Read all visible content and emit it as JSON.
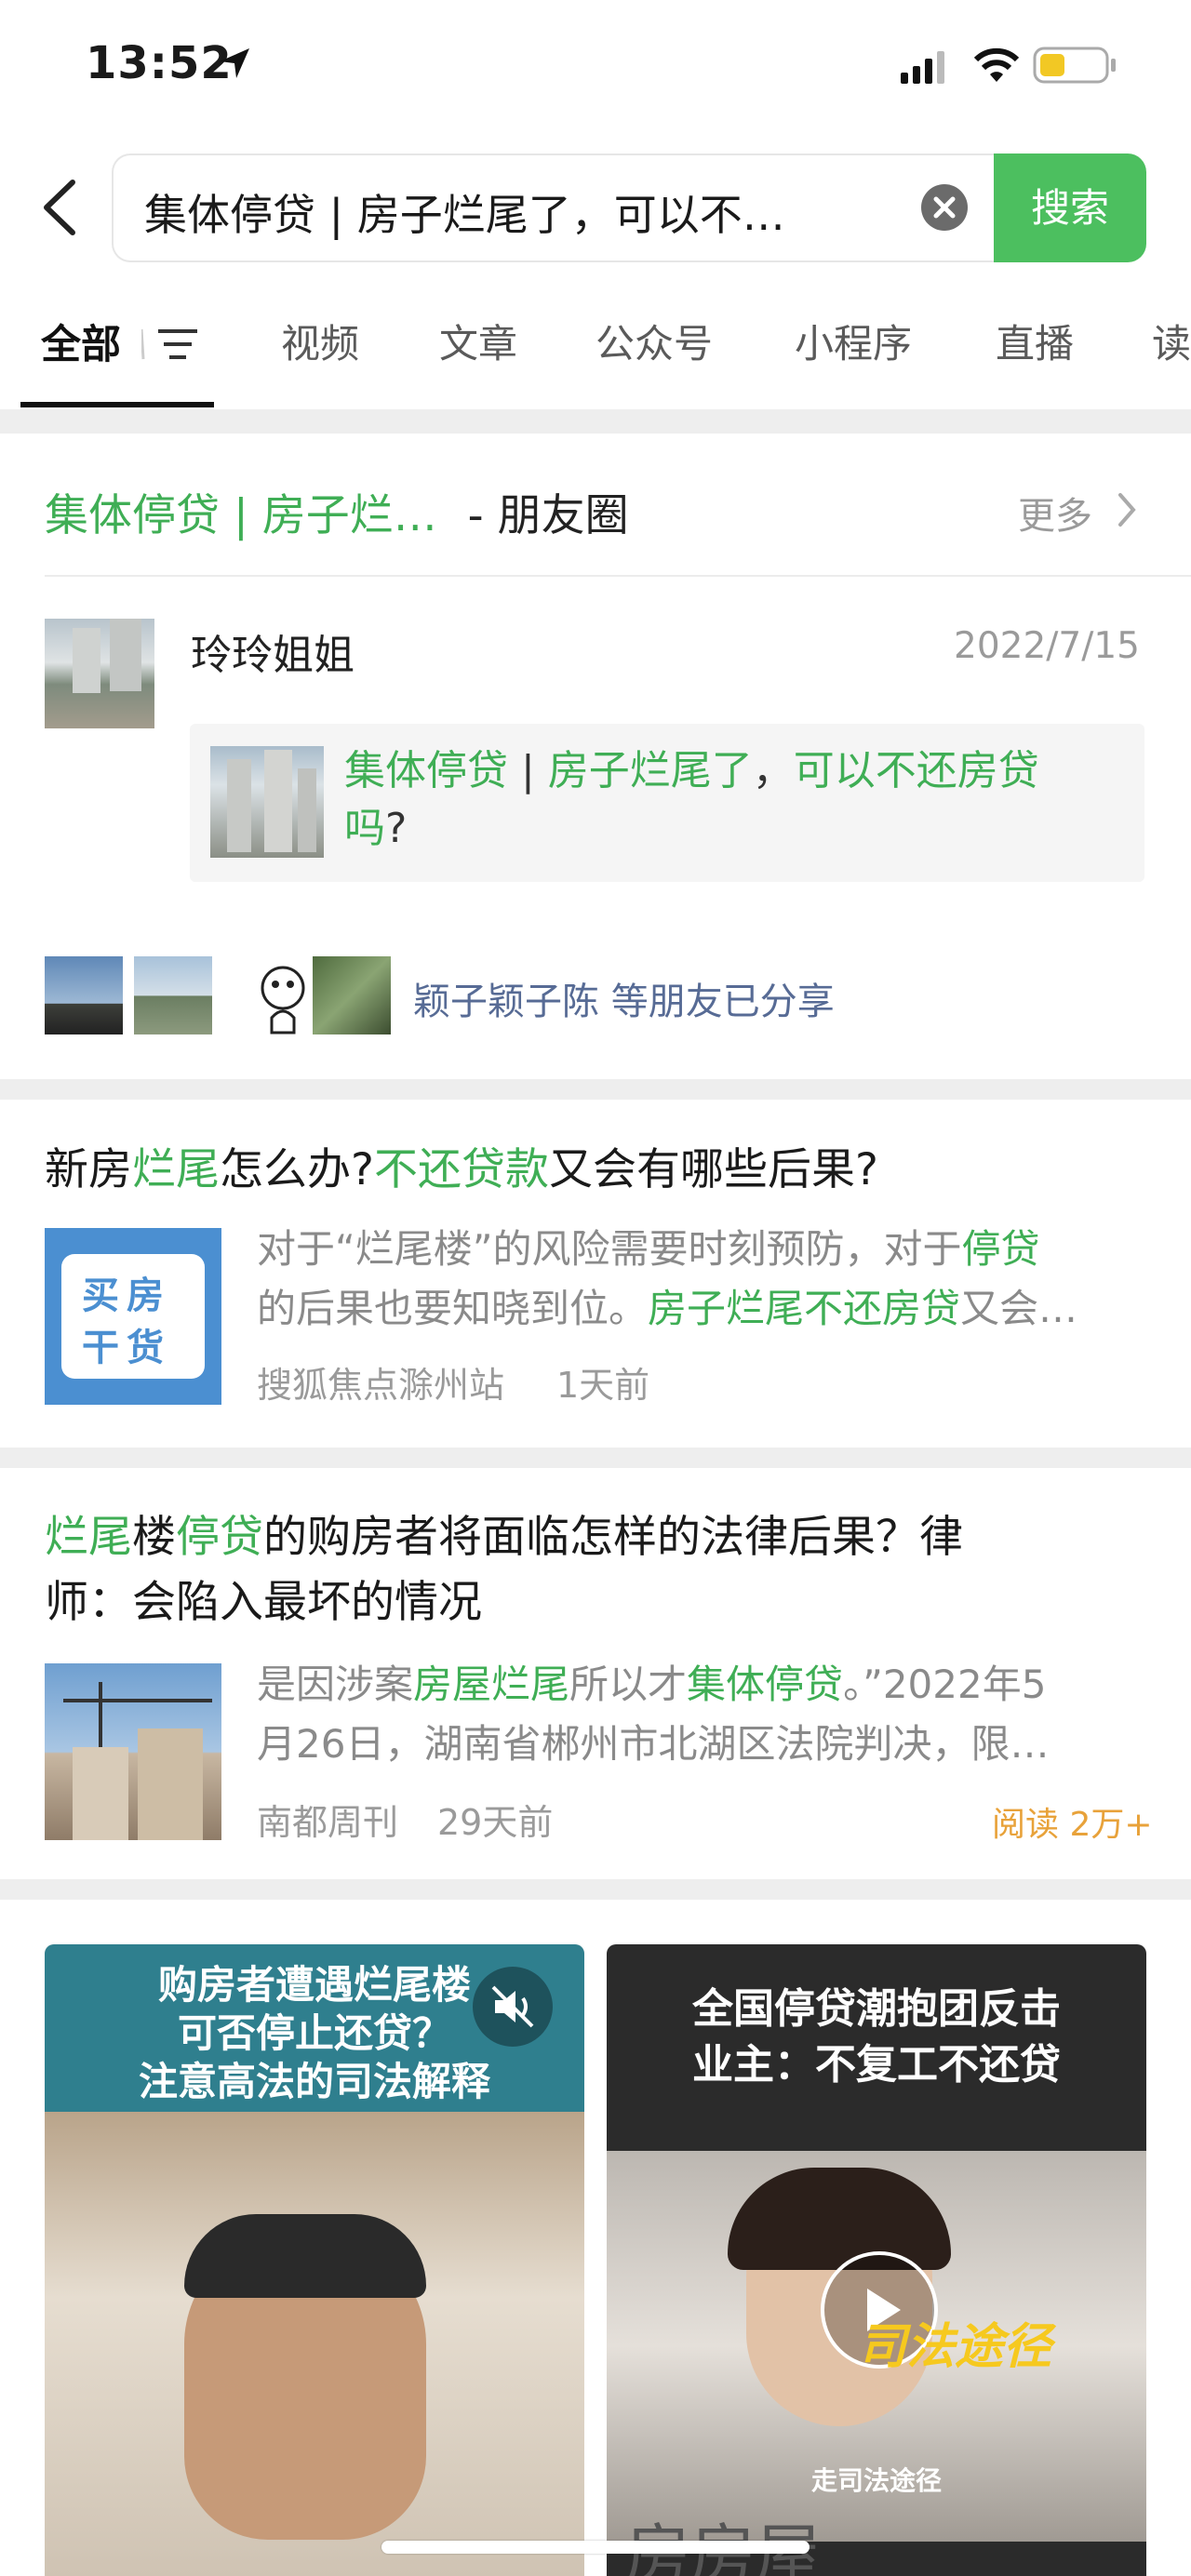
{
  "status_bar": {
    "time": "13:52"
  },
  "search": {
    "query": "集体停贷 | 房子烂尾了，可以不…",
    "button": "搜索"
  },
  "tabs": [
    {
      "label": "全部"
    },
    {
      "label": "视频"
    },
    {
      "label": "文章"
    },
    {
      "label": "公众号"
    },
    {
      "label": "小程序"
    },
    {
      "label": "直播"
    },
    {
      "label": "读"
    }
  ],
  "moments": {
    "header_query": "集体停贷 | 房子烂…",
    "header_suffix": "- 朋友圈",
    "more": "更多",
    "user": "玲玲姐姐",
    "date": "2022/7/15",
    "share_title_parts": [
      "集体停贷",
      " | ",
      "房子烂尾了",
      "，",
      "可以不还房贷",
      "吗",
      "?"
    ],
    "friends_shared": "颖子颖子陈 等朋友已分享"
  },
  "articles": [
    {
      "title_parts": [
        "新房",
        "烂尾",
        "怎么办?",
        "不还贷款",
        "又会有哪些后果?"
      ],
      "snippet_line1_parts": [
        "对于“烂尾楼”的风险需要时刻预防，对于",
        "停贷"
      ],
      "snippet_line2_parts": [
        "的后果也要知晓到位。",
        "房子烂尾不还房贷",
        "又会…"
      ],
      "thumb_text": [
        "买房",
        "干货"
      ],
      "source": "搜狐焦点滁州站",
      "time": "1天前"
    },
    {
      "title_line1_parts": [
        "烂尾",
        "楼",
        "停贷",
        "的购房者将面临怎样的法律后果？律"
      ],
      "title_line2": "师：会陷入最坏的情况",
      "snippet_line1_parts": [
        "是因涉案",
        "房屋烂尾",
        "所以才",
        "集体停贷",
        "。”2022年5"
      ],
      "snippet_line2": "月26日，湖南省郴州市北湖区法院判决，限…",
      "source": "南都周刊",
      "time": "29天前",
      "reads": "阅读 2万+"
    }
  ],
  "videos": [
    {
      "caption_lines": [
        "购房者遭遇烂尾楼",
        "可否停止还贷？",
        "注意高法的司法解释"
      ]
    },
    {
      "caption_lines": [
        "全国停贷潮抱团反击",
        "业主：不复工不还贷"
      ],
      "overlay": "司法途径",
      "bottom_caption": "走司法途径",
      "bottom_big": "房房屋"
    }
  ],
  "colors": {
    "accent": "#3fae55",
    "search_button": "#4cbf5f",
    "reads": "#e8a23a",
    "link_blue": "#576b95"
  }
}
